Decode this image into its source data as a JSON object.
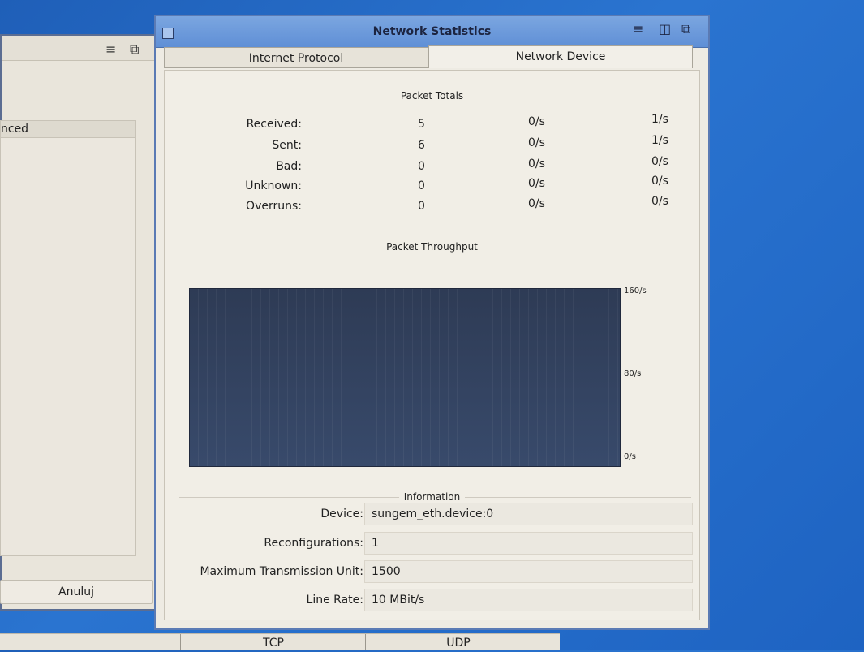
{
  "back_window": {
    "list_header": "nced",
    "cancel_label": "Anuluj"
  },
  "bottom_strip": {
    "tabs": [
      "TCP",
      "UDP"
    ]
  },
  "window": {
    "title": "Network Statistics",
    "tabs": [
      {
        "label": "Internet Protocol",
        "active": false
      },
      {
        "label": "Network Device",
        "active": true
      }
    ]
  },
  "packet_totals": {
    "title": "Packet Totals",
    "rows": [
      {
        "label": "Received:",
        "total": "5",
        "rate": "0/s",
        "peak": "1/s"
      },
      {
        "label": "Sent:",
        "total": "6",
        "rate": "0/s",
        "peak": "1/s"
      },
      {
        "label": "Bad:",
        "total": "0",
        "rate": "0/s",
        "peak": "0/s"
      },
      {
        "label": "Unknown:",
        "total": "0",
        "rate": "0/s",
        "peak": "0/s"
      },
      {
        "label": "Overruns:",
        "total": "0",
        "rate": "0/s",
        "peak": "0/s"
      }
    ]
  },
  "throughput": {
    "title": "Packet Throughput",
    "axis_labels": {
      "top": "160/s",
      "mid": "80/s",
      "bottom": "0/s"
    }
  },
  "information": {
    "title": "Information",
    "rows": [
      {
        "label": "Device:",
        "value": "sungem_eth.device:0"
      },
      {
        "label": "Reconfigurations:",
        "value": "1"
      },
      {
        "label": "Maximum Transmission Unit:",
        "value": "1500"
      },
      {
        "label": "Line Rate:",
        "value": "10 MBit/s"
      }
    ]
  },
  "colors": {
    "desktop": "#2a74d0",
    "titlebar": "#6f9ddc",
    "chart_bg": "#34445f"
  }
}
